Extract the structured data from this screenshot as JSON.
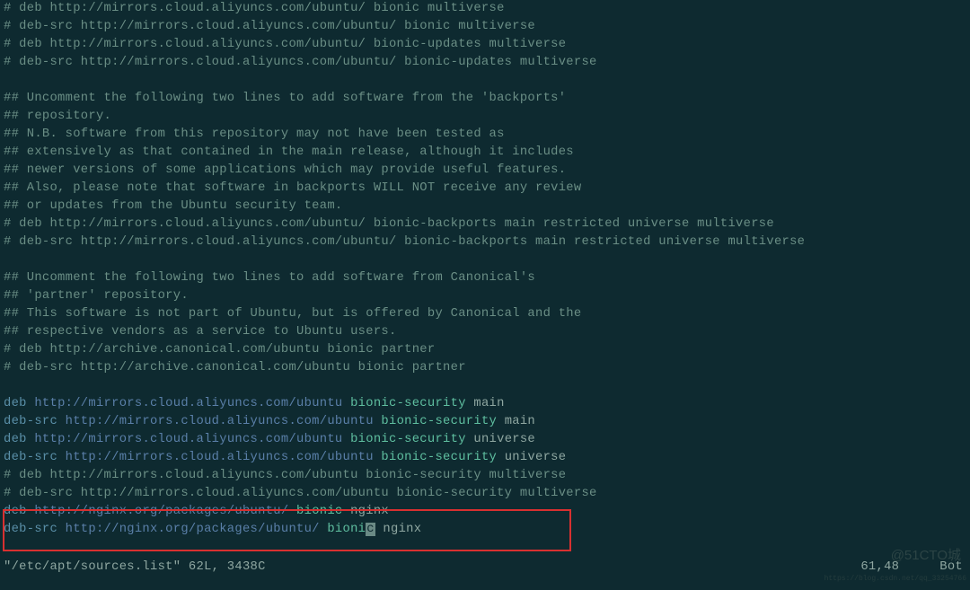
{
  "lines": [
    {
      "segments": [
        {
          "cls": "comment",
          "text": "# deb http://mirrors.cloud.aliyuncs.com/ubuntu/ bionic multiverse"
        }
      ]
    },
    {
      "segments": [
        {
          "cls": "comment",
          "text": "# deb-src http://mirrors.cloud.aliyuncs.com/ubuntu/ bionic multiverse"
        }
      ]
    },
    {
      "segments": [
        {
          "cls": "comment",
          "text": "# deb http://mirrors.cloud.aliyuncs.com/ubuntu/ bionic-updates multiverse"
        }
      ]
    },
    {
      "segments": [
        {
          "cls": "comment",
          "text": "# deb-src http://mirrors.cloud.aliyuncs.com/ubuntu/ bionic-updates multiverse"
        }
      ]
    },
    {
      "empty": true
    },
    {
      "segments": [
        {
          "cls": "comment",
          "text": "## Uncomment the following two lines to add software from the 'backports'"
        }
      ]
    },
    {
      "segments": [
        {
          "cls": "comment",
          "text": "## repository."
        }
      ]
    },
    {
      "segments": [
        {
          "cls": "comment",
          "text": "## N.B. software from this repository may not have been tested as"
        }
      ]
    },
    {
      "segments": [
        {
          "cls": "comment",
          "text": "## extensively as that contained in the main release, although it includes"
        }
      ]
    },
    {
      "segments": [
        {
          "cls": "comment",
          "text": "## newer versions of some applications which may provide useful features."
        }
      ]
    },
    {
      "segments": [
        {
          "cls": "comment",
          "text": "## Also, please note that software in backports WILL NOT receive any review"
        }
      ]
    },
    {
      "segments": [
        {
          "cls": "comment",
          "text": "## or updates from the Ubuntu security team."
        }
      ]
    },
    {
      "segments": [
        {
          "cls": "comment",
          "text": "# deb http://mirrors.cloud.aliyuncs.com/ubuntu/ bionic-backports main restricted universe multiverse"
        }
      ]
    },
    {
      "segments": [
        {
          "cls": "comment",
          "text": "# deb-src http://mirrors.cloud.aliyuncs.com/ubuntu/ bionic-backports main restricted universe multiverse"
        }
      ]
    },
    {
      "empty": true
    },
    {
      "segments": [
        {
          "cls": "comment",
          "text": "## Uncomment the following two lines to add software from Canonical's"
        }
      ]
    },
    {
      "segments": [
        {
          "cls": "comment",
          "text": "## 'partner' repository."
        }
      ]
    },
    {
      "segments": [
        {
          "cls": "comment",
          "text": "## This software is not part of Ubuntu, but is offered by Canonical and the"
        }
      ]
    },
    {
      "segments": [
        {
          "cls": "comment",
          "text": "## respective vendors as a service to Ubuntu users."
        }
      ]
    },
    {
      "segments": [
        {
          "cls": "comment",
          "text": "# deb http://archive.canonical.com/ubuntu bionic partner"
        }
      ]
    },
    {
      "segments": [
        {
          "cls": "comment",
          "text": "# deb-src http://archive.canonical.com/ubuntu bionic partner"
        }
      ]
    },
    {
      "empty": true
    },
    {
      "segments": [
        {
          "cls": "keyword",
          "text": "deb "
        },
        {
          "cls": "url",
          "text": "http://mirrors.cloud.aliyuncs.com/ubuntu"
        },
        {
          "cls": "dist",
          "text": " bionic-security"
        },
        {
          "cls": "component",
          "text": " main"
        }
      ]
    },
    {
      "segments": [
        {
          "cls": "keyword",
          "text": "deb-src "
        },
        {
          "cls": "url",
          "text": "http://mirrors.cloud.aliyuncs.com/ubuntu"
        },
        {
          "cls": "dist",
          "text": " bionic-security"
        },
        {
          "cls": "component",
          "text": " main"
        }
      ]
    },
    {
      "segments": [
        {
          "cls": "keyword",
          "text": "deb "
        },
        {
          "cls": "url",
          "text": "http://mirrors.cloud.aliyuncs.com/ubuntu"
        },
        {
          "cls": "dist",
          "text": " bionic-security"
        },
        {
          "cls": "component",
          "text": " universe"
        }
      ]
    },
    {
      "segments": [
        {
          "cls": "keyword",
          "text": "deb-src "
        },
        {
          "cls": "url",
          "text": "http://mirrors.cloud.aliyuncs.com/ubuntu"
        },
        {
          "cls": "dist",
          "text": " bionic-security"
        },
        {
          "cls": "component",
          "text": " universe"
        }
      ]
    },
    {
      "segments": [
        {
          "cls": "comment",
          "text": "# deb http://mirrors.cloud.aliyuncs.com/ubuntu bionic-security multiverse"
        }
      ]
    },
    {
      "segments": [
        {
          "cls": "comment",
          "text": "# deb-src http://mirrors.cloud.aliyuncs.com/ubuntu bionic-security multiverse"
        }
      ]
    },
    {
      "segments": [
        {
          "cls": "keyword",
          "text": "deb "
        },
        {
          "cls": "url",
          "text": "http://nginx.org/packages/ubuntu/"
        },
        {
          "cls": "dist",
          "text": " bionic"
        },
        {
          "cls": "component",
          "text": " nginx"
        }
      ]
    },
    {
      "segments": [
        {
          "cls": "keyword",
          "text": "deb-src "
        },
        {
          "cls": "url",
          "text": "http://nginx.org/packages/ubuntu/"
        },
        {
          "cls": "dist",
          "text": " bioni"
        },
        {
          "cls": "cursor",
          "text": "c"
        },
        {
          "cls": "component",
          "text": " nginx"
        }
      ]
    }
  ],
  "status": {
    "filename": "\"/etc/apt/sources.list\" 62L, 3438C",
    "position": "61,48",
    "mode": "Bot"
  },
  "watermark": {
    "main": "@51CTO城",
    "url": "https://blog.csdn.net/qq_33254766"
  }
}
